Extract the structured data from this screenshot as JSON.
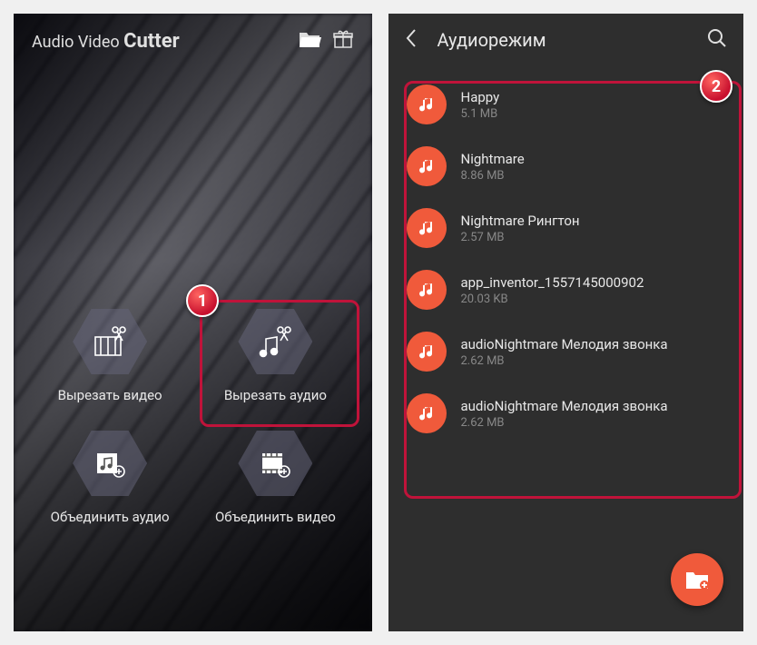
{
  "left": {
    "app_title_light": "Audio Video ",
    "app_title_bold": "Cutter",
    "menu": {
      "cut_video": "Вырезать видео",
      "cut_audio": "Вырезать аудио",
      "merge_audio": "Объединить аудио",
      "merge_video": "Объединить видео"
    },
    "badge": "1"
  },
  "right": {
    "header_title": "Аудиорежим",
    "badge": "2",
    "items": [
      {
        "title": "Happy",
        "size": "5.1 MB"
      },
      {
        "title": "Nightmare",
        "size": "8.86 MB"
      },
      {
        "title": "Nightmare Рингтон",
        "size": "2.57 MB"
      },
      {
        "title": "app_inventor_1557145000902",
        "size": "20.03 KB"
      },
      {
        "title": "audioNightmare Мелодия звонка",
        "size": "2.62 MB"
      },
      {
        "title": "audioNightmare Мелодия звонка",
        "size": "2.62 MB"
      }
    ]
  }
}
